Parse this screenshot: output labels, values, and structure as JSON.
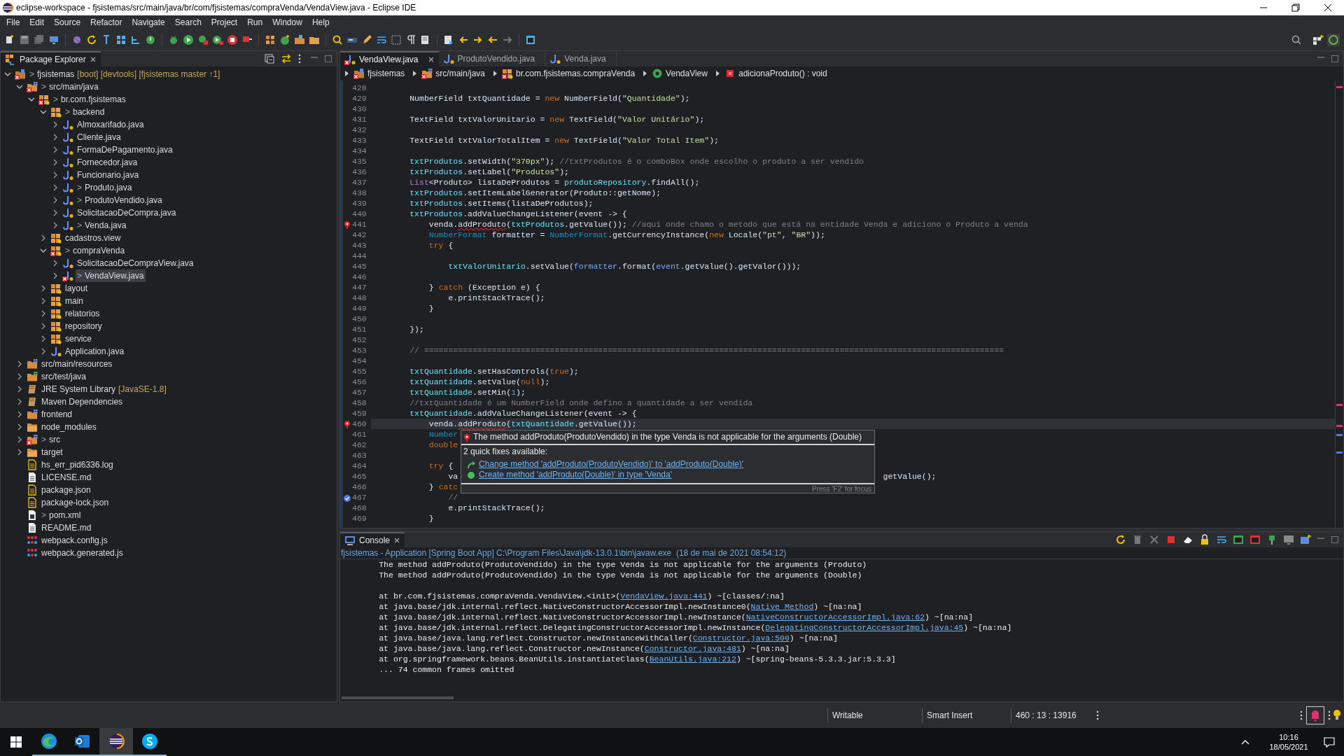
{
  "window": {
    "title": "eclipse-workspace - fjsistemas/src/main/java/br/com/fjsistemas/compraVenda/VendaView.java - Eclipse IDE"
  },
  "menu": [
    "File",
    "Edit",
    "Source",
    "Refactor",
    "Navigate",
    "Search",
    "Project",
    "Run",
    "Window",
    "Help"
  ],
  "package_explorer": {
    "title": "Package Explorer",
    "tree": [
      {
        "label": "fjsistemas",
        "git_mark": ">",
        "decoration": "[boot] [devtools] [fjsistemas master ↑1]",
        "kind": "project",
        "expanded": true,
        "error": true,
        "selected": false,
        "children": [
          {
            "label": "src/main/java",
            "git_mark": ">",
            "kind": "source_folder",
            "expanded": true,
            "error": true,
            "selected": false,
            "children": [
              {
                "label": "br.com.fjsistemas",
                "git_mark": ">",
                "kind": "package",
                "expanded": true,
                "error": true,
                "selected": false,
                "children": [
                  {
                    "label": "backend",
                    "git_mark": ">",
                    "kind": "package",
                    "expanded": true,
                    "error": false,
                    "selected": false,
                    "children": [
                      {
                        "label": "Almoxarifado.java",
                        "kind": "java",
                        "expanded": false,
                        "error": false,
                        "selected": false
                      },
                      {
                        "label": "Cliente.java",
                        "kind": "java",
                        "expanded": false,
                        "error": false,
                        "selected": false
                      },
                      {
                        "label": "FormaDePagamento.java",
                        "kind": "java",
                        "expanded": false,
                        "error": false,
                        "selected": false
                      },
                      {
                        "label": "Fornecedor.java",
                        "kind": "java",
                        "expanded": false,
                        "error": false,
                        "selected": false
                      },
                      {
                        "label": "Funcionario.java",
                        "kind": "java",
                        "expanded": false,
                        "error": false,
                        "selected": false
                      },
                      {
                        "label": "Produto.java",
                        "git_mark": ">",
                        "kind": "java",
                        "expanded": false,
                        "error": false,
                        "selected": false
                      },
                      {
                        "label": "ProdutoVendido.java",
                        "git_mark": ">",
                        "kind": "java",
                        "expanded": false,
                        "error": false,
                        "selected": false
                      },
                      {
                        "label": "SolicitacaoDeCompra.java",
                        "kind": "java",
                        "expanded": false,
                        "error": false,
                        "selected": false
                      },
                      {
                        "label": "Venda.java",
                        "git_mark": ">",
                        "kind": "java",
                        "expanded": false,
                        "error": false,
                        "selected": false
                      }
                    ]
                  },
                  {
                    "label": "cadastros.view",
                    "kind": "package",
                    "expanded": false,
                    "error": false,
                    "selected": false
                  },
                  {
                    "label": "compraVenda",
                    "git_mark": ">",
                    "kind": "package",
                    "expanded": true,
                    "error": true,
                    "selected": false,
                    "children": [
                      {
                        "label": "SolicitacaoDeCompraView.java",
                        "kind": "java",
                        "expanded": false,
                        "error": false,
                        "selected": false
                      },
                      {
                        "label": "VendaView.java",
                        "git_mark": ">",
                        "kind": "java",
                        "expanded": false,
                        "error": true,
                        "selected": true
                      }
                    ]
                  },
                  {
                    "label": "layout",
                    "kind": "package",
                    "expanded": false,
                    "error": false,
                    "selected": false
                  },
                  {
                    "label": "main",
                    "kind": "package",
                    "expanded": false,
                    "error": false,
                    "selected": false
                  },
                  {
                    "label": "relatorios",
                    "kind": "package",
                    "expanded": false,
                    "error": false,
                    "selected": false
                  },
                  {
                    "label": "repository",
                    "kind": "package",
                    "expanded": false,
                    "error": false,
                    "selected": false
                  },
                  {
                    "label": "service",
                    "kind": "package",
                    "expanded": false,
                    "error": false,
                    "selected": false
                  },
                  {
                    "label": "Application.java",
                    "kind": "java",
                    "expanded": false,
                    "error": false,
                    "selected": false
                  }
                ]
              }
            ]
          },
          {
            "label": "src/main/resources",
            "kind": "source_folder",
            "expanded": false,
            "error": false,
            "selected": false
          },
          {
            "label": "src/test/java",
            "kind": "test_folder",
            "expanded": false,
            "error": false,
            "selected": false
          },
          {
            "label": "JRE System Library",
            "decoration": "[JavaSE-1.8]",
            "kind": "library",
            "expanded": false,
            "error": false,
            "selected": false
          },
          {
            "label": "Maven Dependencies",
            "kind": "library",
            "expanded": false,
            "error": false,
            "selected": false
          },
          {
            "label": "frontend",
            "kind": "source_folder",
            "expanded": false,
            "error": false,
            "selected": false
          },
          {
            "label": "node_modules",
            "kind": "folder",
            "expanded": false,
            "error": false,
            "selected": false
          },
          {
            "label": "src",
            "git_mark": ">",
            "kind": "source_folder",
            "expanded": false,
            "error": true,
            "selected": false
          },
          {
            "label": "target",
            "kind": "folder",
            "expanded": false,
            "error": false,
            "selected": false
          },
          {
            "label": "hs_err_pid6336.log",
            "kind": "data_file",
            "error": false,
            "selected": false
          },
          {
            "label": "LICENSE.md",
            "kind": "text_file",
            "error": false,
            "selected": false
          },
          {
            "label": "package.json",
            "kind": "data_file",
            "error": false,
            "selected": false
          },
          {
            "label": "package-lock.json",
            "kind": "data_file",
            "error": false,
            "selected": false
          },
          {
            "label": "pom.xml",
            "git_mark": ">",
            "kind": "maven_file",
            "error": false,
            "selected": false
          },
          {
            "label": "README.md",
            "kind": "text_file",
            "error": false,
            "selected": false
          },
          {
            "label": "webpack.config.js",
            "kind": "webpack_file",
            "error": false,
            "selected": false
          },
          {
            "label": "webpack.generated.js",
            "kind": "webpack_file",
            "error": false,
            "selected": false
          }
        ]
      }
    ]
  },
  "editor": {
    "tabs": [
      {
        "label": "VendaView.java",
        "selected": true,
        "error": true
      },
      {
        "label": "ProdutoVendido.java",
        "selected": false,
        "error": false
      },
      {
        "label": "Venda.java",
        "selected": false,
        "error": false
      }
    ],
    "breadcrumb": [
      {
        "label": "fjsistemas",
        "kind": "project"
      },
      {
        "label": "src/main/java",
        "kind": "source_folder"
      },
      {
        "label": "br.com.fjsistemas.compraVenda",
        "kind": "package"
      },
      {
        "label": "VendaView",
        "kind": "class"
      },
      {
        "label": "adicionaProduto() : void",
        "kind": "method"
      }
    ],
    "lines": [
      {
        "number": "428",
        "current": false,
        "error": false,
        "task": false
      },
      {
        "number": "429",
        "current": false,
        "error": false,
        "task": false,
        "segments": [
          {
            "text": "        NumberField txtQuantidade = ",
            "kind": "plain"
          },
          {
            "text": "new",
            "kind": "keyword"
          },
          {
            "text": " NumberField(",
            "kind": "plain"
          },
          {
            "text": "\"Quantidade\"",
            "kind": "string"
          },
          {
            "text": ");",
            "kind": "plain"
          }
        ]
      },
      {
        "number": "430",
        "current": false,
        "error": false,
        "task": false
      },
      {
        "number": "431",
        "current": false,
        "error": false,
        "task": false,
        "segments": [
          {
            "text": "        TextField txtValorUnitario = ",
            "kind": "plain"
          },
          {
            "text": "new",
            "kind": "keyword"
          },
          {
            "text": " TextField(",
            "kind": "plain"
          },
          {
            "text": "\"Valor Unitário\"",
            "kind": "string"
          },
          {
            "text": ");",
            "kind": "plain"
          }
        ]
      },
      {
        "number": "432",
        "current": false,
        "error": false,
        "task": false
      },
      {
        "number": "433",
        "current": false,
        "error": false,
        "task": false,
        "segments": [
          {
            "text": "        TextField txtValorTotalItem = ",
            "kind": "plain"
          },
          {
            "text": "new",
            "kind": "keyword"
          },
          {
            "text": " TextField(",
            "kind": "plain"
          },
          {
            "text": "\"Valor Total Item\"",
            "kind": "string"
          },
          {
            "text": ");",
            "kind": "plain"
          }
        ]
      },
      {
        "number": "434",
        "current": false,
        "error": false,
        "task": false
      },
      {
        "number": "435",
        "current": false,
        "error": false,
        "task": false,
        "segments": [
          {
            "text": "        txtProdutos",
            "kind": "field"
          },
          {
            "text": ".setWidth(",
            "kind": "plain"
          },
          {
            "text": "\"370px\"",
            "kind": "string"
          },
          {
            "text": "); ",
            "kind": "plain"
          },
          {
            "text": "//txtProdutos é o comboBox onde escolho o produto a ser vendido",
            "kind": "comment"
          }
        ]
      },
      {
        "number": "436",
        "current": false,
        "error": false,
        "task": false,
        "segments": [
          {
            "text": "        txtProdutos",
            "kind": "field"
          },
          {
            "text": ".setLabel(",
            "kind": "plain"
          },
          {
            "text": "\"Produtos\"",
            "kind": "string"
          },
          {
            "text": ");",
            "kind": "plain"
          }
        ]
      },
      {
        "number": "437",
        "current": false,
        "error": false,
        "task": false,
        "segments": [
          {
            "text": "        List",
            "kind": "interface"
          },
          {
            "text": "<Produto> listaDeProdutos = ",
            "kind": "plain"
          },
          {
            "text": "produtoRepository",
            "kind": "field"
          },
          {
            "text": ".findAll();",
            "kind": "plain"
          }
        ]
      },
      {
        "number": "438",
        "current": false,
        "error": false,
        "task": false,
        "segments": [
          {
            "text": "        txtProdutos",
            "kind": "field"
          },
          {
            "text": ".setItemLabelGenerator(Produto::getNome);",
            "kind": "plain"
          }
        ]
      },
      {
        "number": "439",
        "current": false,
        "error": false,
        "task": false,
        "segments": [
          {
            "text": "        txtProdutos",
            "kind": "field"
          },
          {
            "text": ".setItems(listaDeProdutos);",
            "kind": "plain"
          }
        ]
      },
      {
        "number": "440",
        "current": false,
        "error": false,
        "task": false,
        "segments": [
          {
            "text": "        txtProdutos",
            "kind": "field"
          },
          {
            "text": ".addValueChangeListener(event -> {",
            "kind": "plain"
          }
        ]
      },
      {
        "number": "441",
        "current": false,
        "error": true,
        "task": false,
        "segments": [
          {
            "text": "            venda.",
            "kind": "plain"
          },
          {
            "text": "addProduto",
            "kind": "error"
          },
          {
            "text": "(",
            "kind": "plain"
          },
          {
            "text": "txtProdutos",
            "kind": "field"
          },
          {
            "text": ".getValue()); ",
            "kind": "plain"
          },
          {
            "text": "//aqui onde chamo o metodo que está na entidade Venda e adiciono o Produto a venda",
            "kind": "comment"
          }
        ]
      },
      {
        "number": "442",
        "current": false,
        "error": false,
        "task": false,
        "segments": [
          {
            "text": "            NumberFormat",
            "kind": "type"
          },
          {
            "text": " formatter = ",
            "kind": "plain"
          },
          {
            "text": "NumberFormat",
            "kind": "type"
          },
          {
            "text": ".getCurrencyInstance(",
            "kind": "plain"
          },
          {
            "text": "new",
            "kind": "keyword"
          },
          {
            "text": " Locale(",
            "kind": "plain"
          },
          {
            "text": "\"pt\"",
            "kind": "string"
          },
          {
            "text": ", ",
            "kind": "plain"
          },
          {
            "text": "\"BR\"",
            "kind": "string"
          },
          {
            "text": "));",
            "kind": "plain"
          }
        ]
      },
      {
        "number": "443",
        "current": false,
        "error": false,
        "task": false,
        "segments": [
          {
            "text": "            try",
            "kind": "keyword"
          },
          {
            "text": " {",
            "kind": "plain"
          }
        ]
      },
      {
        "number": "444",
        "current": false,
        "error": false,
        "task": false
      },
      {
        "number": "445",
        "current": false,
        "error": false,
        "task": false,
        "segments": [
          {
            "text": "                txtValorUnitario",
            "kind": "field"
          },
          {
            "text": ".setValue(",
            "kind": "plain"
          },
          {
            "text": "formatter",
            "kind": "variable"
          },
          {
            "text": ".format(",
            "kind": "plain"
          },
          {
            "text": "event",
            "kind": "variable"
          },
          {
            "text": ".getValue().getValor()));",
            "kind": "plain"
          }
        ]
      },
      {
        "number": "446",
        "current": false,
        "error": false,
        "task": false
      },
      {
        "number": "447",
        "current": false,
        "error": false,
        "task": false,
        "segments": [
          {
            "text": "            } ",
            "kind": "plain"
          },
          {
            "text": "catch",
            "kind": "keyword"
          },
          {
            "text": " (Exception e) {",
            "kind": "plain"
          }
        ]
      },
      {
        "number": "448",
        "current": false,
        "error": false,
        "task": false,
        "segments": [
          {
            "text": "                e.printStackTrace();",
            "kind": "plain"
          }
        ]
      },
      {
        "number": "449",
        "current": false,
        "error": false,
        "task": false,
        "segments": [
          {
            "text": "            }",
            "kind": "plain"
          }
        ]
      },
      {
        "number": "450",
        "current": false,
        "error": false,
        "task": false
      },
      {
        "number": "451",
        "current": false,
        "error": false,
        "task": false,
        "segments": [
          {
            "text": "        });",
            "kind": "plain"
          }
        ]
      },
      {
        "number": "452",
        "current": false,
        "error": false,
        "task": false
      },
      {
        "number": "453",
        "current": false,
        "error": false,
        "task": false,
        "segments": [
          {
            "text": "        // ========================================================================================================================",
            "kind": "comment"
          }
        ]
      },
      {
        "number": "454",
        "current": false,
        "error": false,
        "task": false
      },
      {
        "number": "455",
        "current": false,
        "error": false,
        "task": false,
        "segments": [
          {
            "text": "        txtQuantidade",
            "kind": "field"
          },
          {
            "text": ".setHasControls(",
            "kind": "plain"
          },
          {
            "text": "true",
            "kind": "keyword"
          },
          {
            "text": ");",
            "kind": "plain"
          }
        ]
      },
      {
        "number": "456",
        "current": false,
        "error": false,
        "task": false,
        "segments": [
          {
            "text": "        txtQuantidade",
            "kind": "field"
          },
          {
            "text": ".setValue(",
            "kind": "plain"
          },
          {
            "text": "null",
            "kind": "keyword"
          },
          {
            "text": ");",
            "kind": "plain"
          }
        ]
      },
      {
        "number": "457",
        "current": false,
        "error": false,
        "task": false,
        "segments": [
          {
            "text": "        txtQuantidade",
            "kind": "field"
          },
          {
            "text": ".setMin(",
            "kind": "plain"
          },
          {
            "text": "1",
            "kind": "number"
          },
          {
            "text": ");",
            "kind": "plain"
          }
        ]
      },
      {
        "number": "458",
        "current": false,
        "error": false,
        "task": false,
        "segments": [
          {
            "text": "        //txtQuantidade é um NumberField onde defino a quantidade a ser vendida",
            "kind": "comment"
          }
        ]
      },
      {
        "number": "459",
        "current": false,
        "error": false,
        "task": false,
        "segments": [
          {
            "text": "        txtQuantidade",
            "kind": "field"
          },
          {
            "text": ".addValueChangeListener(event -> {",
            "kind": "plain"
          }
        ]
      },
      {
        "number": "460",
        "current": true,
        "error": true,
        "task": false,
        "segments": [
          {
            "text": "            venda.",
            "kind": "plain"
          },
          {
            "text": "addProduto",
            "kind": "error"
          },
          {
            "text": "(",
            "kind": "plain"
          },
          {
            "text": "txtQuantidade",
            "kind": "field"
          },
          {
            "text": ".getValue());",
            "kind": "plain"
          }
        ]
      },
      {
        "number": "461",
        "current": false,
        "error": false,
        "task": false,
        "segments": [
          {
            "text": "            Number",
            "kind": "type"
          }
        ]
      },
      {
        "number": "462",
        "current": false,
        "error": false,
        "task": false,
        "segments": [
          {
            "text": "            double",
            "kind": "keyword"
          }
        ]
      },
      {
        "number": "463",
        "current": false,
        "error": false,
        "task": false
      },
      {
        "number": "464",
        "current": false,
        "error": false,
        "task": false,
        "segments": [
          {
            "text": "            try",
            "kind": "keyword"
          },
          {
            "text": " {",
            "kind": "plain"
          }
        ]
      },
      {
        "number": "465",
        "current": false,
        "error": false,
        "task": false,
        "segments": [
          {
            "text": "                va",
            "kind": "plain"
          }
        ],
        "tail": [
          {
            "text": "getValue();",
            "kind": "plain"
          }
        ]
      },
      {
        "number": "466",
        "current": false,
        "error": false,
        "task": false,
        "segments": [
          {
            "text": "            } ",
            "kind": "plain"
          },
          {
            "text": "catc",
            "kind": "keyword"
          }
        ]
      },
      {
        "number": "467",
        "current": false,
        "error": false,
        "task": true,
        "segments": [
          {
            "text": "                //",
            "kind": "comment"
          }
        ]
      },
      {
        "number": "468",
        "current": false,
        "error": false,
        "task": false,
        "segments": [
          {
            "text": "                e.printStackTrace();",
            "kind": "plain"
          }
        ]
      },
      {
        "number": "469",
        "current": false,
        "error": false,
        "task": false,
        "segments": [
          {
            "text": "            }",
            "kind": "plain"
          }
        ]
      }
    ],
    "hover": {
      "message": "The method addProduto(ProdutoVendido) in the type Venda is not applicable for the arguments (Double)",
      "fixes_heading": "2 quick fixes available:",
      "fixes": [
        {
          "label": "Change method 'addProduto(ProdutoVendido)' to 'addProduto(Double)'",
          "kind": "change"
        },
        {
          "label": "Create method 'addProduto(Double)' in type 'Venda'",
          "kind": "create"
        }
      ],
      "footer": "Press 'F2' for focus"
    }
  },
  "console": {
    "title": "Console",
    "launch": "fjsistemas - Application [Spring Boot App] C:\\Program Files\\Java\\jdk-13.0.1\\bin\\javaw.exe  (18 de mai de 2021 08:54:12)",
    "messages": [
      "        The method addProduto(ProdutoVendido) in the type Venda is not applicable for the arguments (Produto)",
      "        The method addProduto(ProdutoVendido) in the type Venda is not applicable for the arguments (Double)"
    ],
    "stack_trace": [
      [
        {
          "text": "        at br.com.fjsistemas.compraVenda.VendaView.<init>(",
          "kind": "plain"
        },
        {
          "text": "VendaView.java:441",
          "kind": "link"
        },
        {
          "text": ") ~[classes/:na]",
          "kind": "plain"
        }
      ],
      [
        {
          "text": "        at java.base/jdk.internal.reflect.NativeConstructorAccessorImpl.newInstance0(",
          "kind": "plain"
        },
        {
          "text": "Native Method",
          "kind": "link"
        },
        {
          "text": ") ~[na:na]",
          "kind": "plain"
        }
      ],
      [
        {
          "text": "        at java.base/jdk.internal.reflect.NativeConstructorAccessorImpl.newInstance(",
          "kind": "plain"
        },
        {
          "text": "NativeConstructorAccessorImpl.java:62",
          "kind": "link"
        },
        {
          "text": ") ~[na:na]",
          "kind": "plain"
        }
      ],
      [
        {
          "text": "        at java.base/jdk.internal.reflect.DelegatingConstructorAccessorImpl.newInstance(",
          "kind": "plain"
        },
        {
          "text": "DelegatingConstructorAccessorImpl.java:45",
          "kind": "link"
        },
        {
          "text": ") ~[na:na]",
          "kind": "plain"
        }
      ],
      [
        {
          "text": "        at java.base/java.lang.reflect.Constructor.newInstanceWithCaller(",
          "kind": "plain"
        },
        {
          "text": "Constructor.java:500",
          "kind": "link"
        },
        {
          "text": ") ~[na:na]",
          "kind": "plain"
        }
      ],
      [
        {
          "text": "        at java.base/java.lang.reflect.Constructor.newInstance(",
          "kind": "plain"
        },
        {
          "text": "Constructor.java:481",
          "kind": "link"
        },
        {
          "text": ") ~[na:na]",
          "kind": "plain"
        }
      ],
      [
        {
          "text": "        at org.springframework.beans.BeanUtils.instantiateClass(",
          "kind": "plain"
        },
        {
          "text": "BeanUtils.java:212",
          "kind": "link"
        },
        {
          "text": ") ~[spring-beans-5.3.3.jar:5.3.3]",
          "kind": "plain"
        }
      ],
      [
        {
          "text": "        ... 74 common frames omitted",
          "kind": "plain"
        }
      ]
    ]
  },
  "status_bar": [
    "Writable",
    "Smart Insert",
    "460 : 13 : 13916"
  ],
  "taskbar": {
    "apps": [
      {
        "kind": "browser",
        "selected": false
      },
      {
        "kind": "mail",
        "selected": false
      },
      {
        "kind": "ide",
        "selected": true
      },
      {
        "kind": "chat",
        "selected": false
      }
    ],
    "time": "10:16",
    "date": "18/05/2021"
  }
}
